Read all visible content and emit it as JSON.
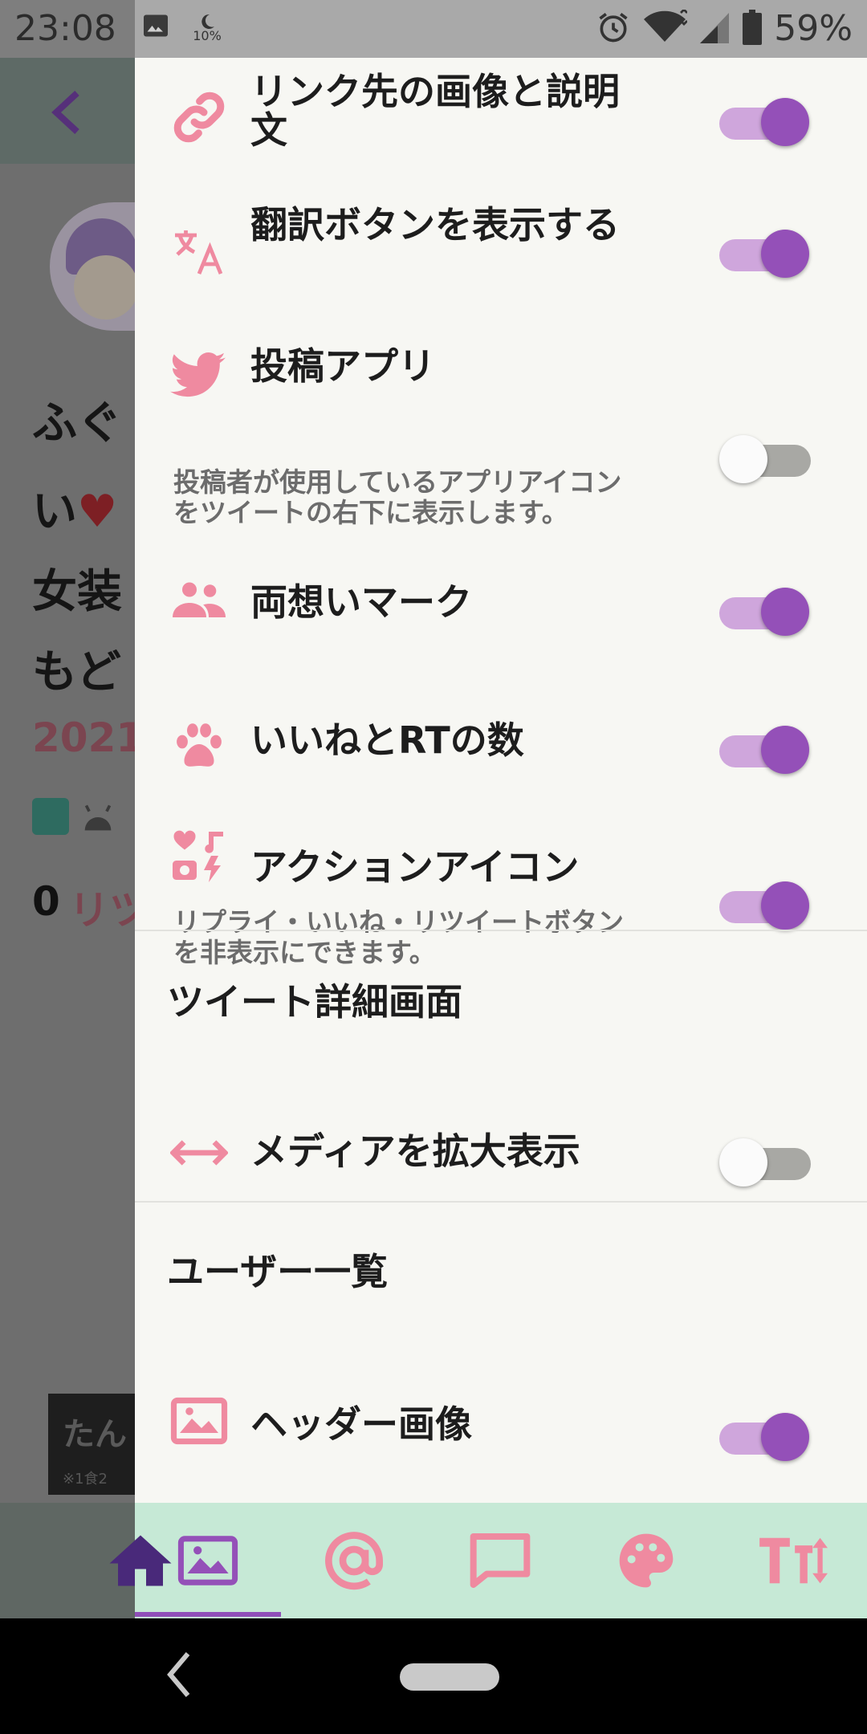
{
  "status_bar": {
    "time": "23:08",
    "moon_percent": "10%",
    "battery_percent": "59%"
  },
  "background": {
    "line1": "ふぐ",
    "line2": "い",
    "line3": "女装",
    "line4": "もど",
    "date": "2021",
    "rt_count": "0",
    "rt_label": "リツ",
    "thumb_text": "たん",
    "thumb_sub": "※1食2"
  },
  "settings": {
    "rows": [
      {
        "title": "リンク先の画像と説明文",
        "icon": "link-icon",
        "on": true
      },
      {
        "title": "翻訳ボタンを表示する",
        "icon": "translate-icon",
        "on": true
      },
      {
        "title": "投稿アプリ",
        "desc": "投稿者が使用しているアプリアイコンをツイートの右下に表示します。",
        "icon": "twitter-bird-icon",
        "on": false
      },
      {
        "title": "両想いマーク",
        "icon": "people-icon",
        "on": true
      },
      {
        "title": "いいねとRTの数",
        "icon": "paw-icon",
        "on": true
      },
      {
        "title": "アクションアイコン",
        "desc": "リプライ・いいね・リツイートボタンを非表示にできます。",
        "icon": "action-icons-icon",
        "on": true
      },
      {
        "title": "メディアを拡大表示",
        "icon": "expand-arrows-icon",
        "on": false
      },
      {
        "title": "ヘッダー画像",
        "icon": "image-icon",
        "on": true
      }
    ],
    "sections": {
      "tweet_detail": "ツイート詳細画面",
      "user_list": "ユーザー一覧"
    }
  },
  "tabs": [
    "home-tab",
    "image-tab",
    "mention-tab",
    "chat-tab",
    "palette-tab",
    "font-size-tab"
  ],
  "colors": {
    "accent": "#9450b8",
    "icon_pink": "#ef8aa0",
    "tab_bar": "#c6e9d6",
    "drawer_bg": "#f7f7f3"
  }
}
